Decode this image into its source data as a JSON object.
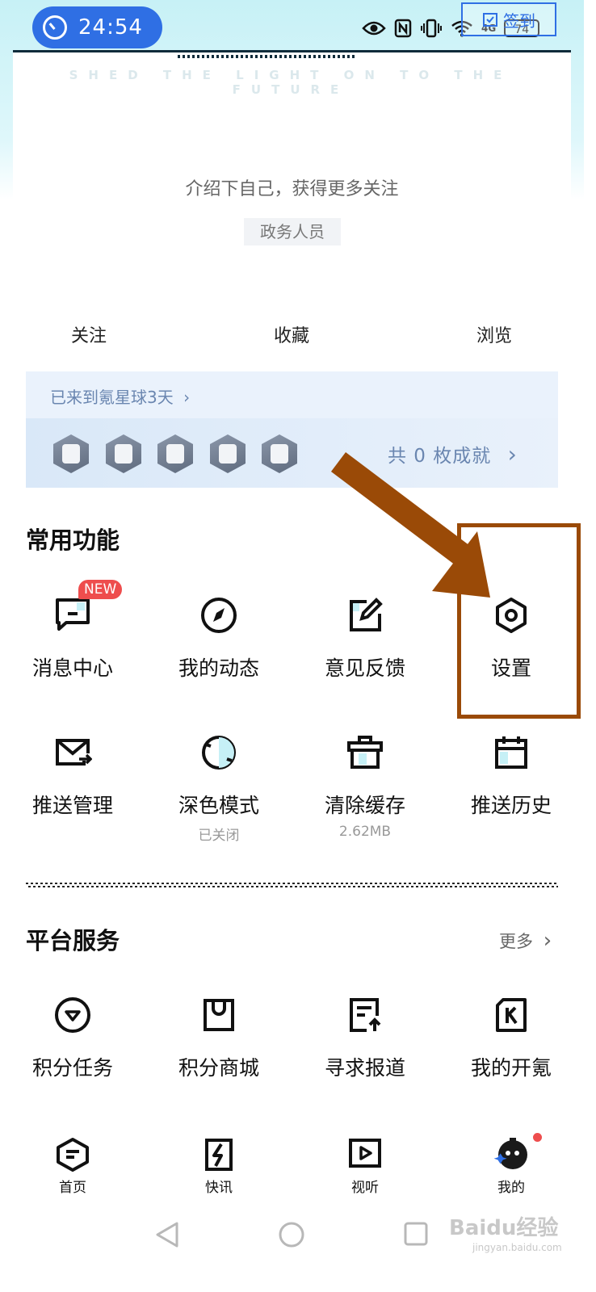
{
  "status_bar": {
    "timer": "24:54",
    "battery": "74",
    "network": "4G",
    "checkin_label": "签到"
  },
  "banner": {
    "slogan": "SHED THE LIGHT ON TO THE FUTURE"
  },
  "profile": {
    "intro": "介绍下自己，获得更多关注",
    "role": "政务人员"
  },
  "stats": [
    {
      "label": "关注"
    },
    {
      "label": "收藏"
    },
    {
      "label": "浏览"
    }
  ],
  "achievements": {
    "days_text": "已来到氪星球3天",
    "total_text": "共 0 枚成就"
  },
  "common_functions": {
    "title": "常用功能",
    "new_badge": "NEW",
    "items": [
      {
        "label": "消息中心",
        "icon": "message-icon"
      },
      {
        "label": "我的动态",
        "icon": "compass-icon"
      },
      {
        "label": "意见反馈",
        "icon": "edit-icon"
      },
      {
        "label": "设置",
        "icon": "settings-icon"
      },
      {
        "label": "推送管理",
        "icon": "mail-icon"
      },
      {
        "label": "深色模式",
        "sub": "已关闭",
        "icon": "dark-mode-icon"
      },
      {
        "label": "清除缓存",
        "sub": "2.62MB",
        "icon": "trash-icon"
      },
      {
        "label": "推送历史",
        "icon": "calendar-icon"
      }
    ]
  },
  "platform_services": {
    "title": "平台服务",
    "more_label": "更多",
    "items": [
      {
        "label": "积分任务",
        "icon": "diamond-icon"
      },
      {
        "label": "积分商城",
        "icon": "bag-icon"
      },
      {
        "label": "寻求报道",
        "icon": "report-icon"
      },
      {
        "label": "我的开氪",
        "icon": "k-icon"
      }
    ]
  },
  "bottom_nav": [
    {
      "label": "首页",
      "icon": "home-icon"
    },
    {
      "label": "快讯",
      "icon": "flash-icon"
    },
    {
      "label": "视听",
      "icon": "play-icon"
    },
    {
      "label": "我的",
      "icon": "robot-avatar-icon"
    }
  ],
  "watermark": {
    "text": "Baidu经验",
    "sub": "jingyan.baidu.com"
  },
  "colors": {
    "accent_blue": "#2f6fe4",
    "annotation_brown": "#9a4a07",
    "badge_red": "#ee4d4d"
  }
}
